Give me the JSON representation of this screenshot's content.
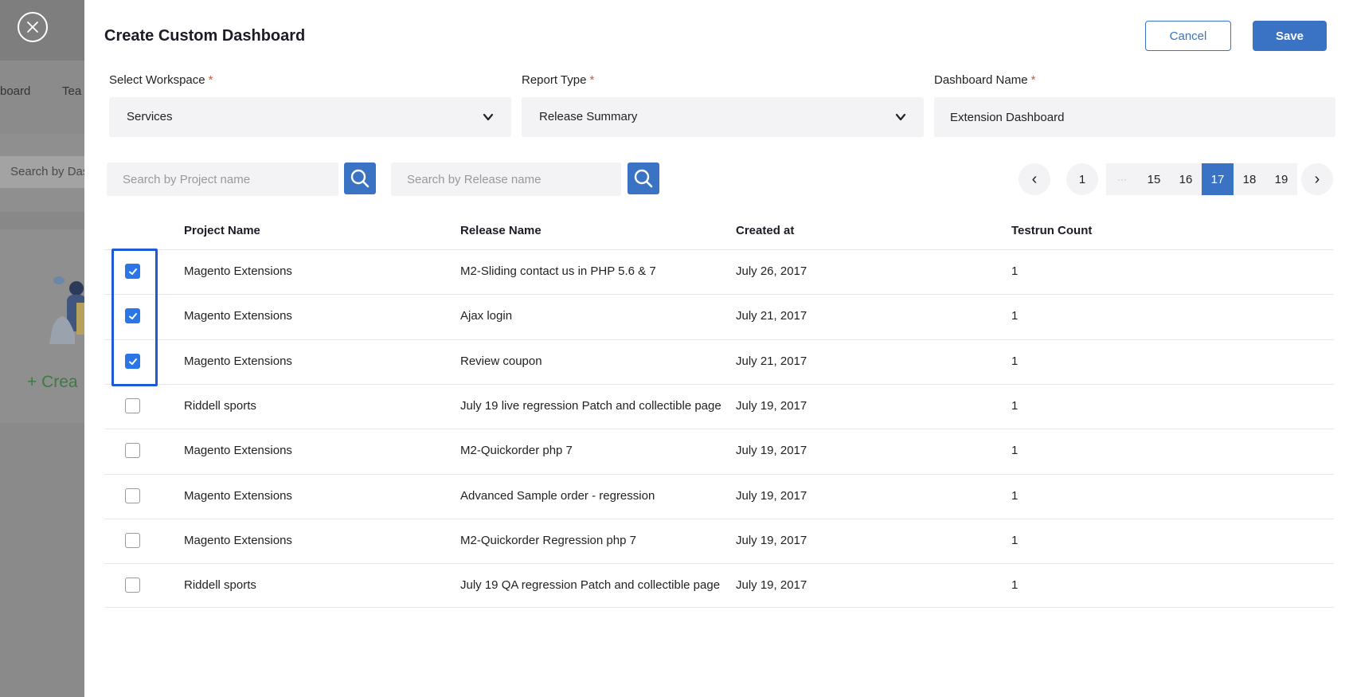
{
  "background": {
    "tab_1": "board",
    "tab_2": "Tea",
    "search_placeholder": "Search by Das",
    "create_label": "+ Crea"
  },
  "header": {
    "title": "Create Custom Dashboard",
    "cancel_label": "Cancel",
    "save_label": "Save"
  },
  "form": {
    "workspace_label": "Select Workspace",
    "workspace_value": "Services",
    "report_type_label": "Report Type",
    "report_type_value": "Release Summary",
    "dashboard_name_label": "Dashboard Name",
    "dashboard_name_value": "Extension Dashboard",
    "required_mark": "*"
  },
  "search": {
    "project_placeholder": "Search by Project name",
    "release_placeholder": "Search by Release name"
  },
  "pagination": {
    "prev": "‹",
    "first": "1",
    "ellipsis": "···",
    "pages": [
      "15",
      "16",
      "17",
      "18",
      "19"
    ],
    "current": "17",
    "next": "›"
  },
  "table": {
    "columns": [
      "Project Name",
      "Release Name",
      "Created at",
      "Testrun Count"
    ],
    "rows": [
      {
        "checked": true,
        "project": "Magento Extensions",
        "release": "M2-Sliding contact us in PHP 5.6 & 7",
        "created": "July 26, 2017",
        "count": "1"
      },
      {
        "checked": true,
        "project": "Magento Extensions",
        "release": "Ajax login",
        "created": "July 21, 2017",
        "count": "1"
      },
      {
        "checked": true,
        "project": "Magento Extensions",
        "release": "Review coupon",
        "created": "July 21, 2017",
        "count": "1"
      },
      {
        "checked": false,
        "project": "Riddell sports",
        "release": "July 19 live regression Patch and collectible page",
        "created": "July 19, 2017",
        "count": "1"
      },
      {
        "checked": false,
        "project": "Magento Extensions",
        "release": "M2-Quickorder php 7",
        "created": "July 19, 2017",
        "count": "1"
      },
      {
        "checked": false,
        "project": "Magento Extensions",
        "release": "Advanced Sample order - regression",
        "created": "July 19, 2017",
        "count": "1"
      },
      {
        "checked": false,
        "project": "Magento Extensions",
        "release": "M2-Quickorder Regression php 7",
        "created": "July 19, 2017",
        "count": "1"
      },
      {
        "checked": false,
        "project": "Riddell sports",
        "release": "July 19 QA regression Patch and collectible page",
        "created": "July 19, 2017",
        "count": "1"
      }
    ]
  },
  "colors": {
    "accent": "#3a73c4",
    "checkbox_checked": "#2b76e6",
    "required": "#e0542a",
    "highlight": "#1f5ad6"
  }
}
